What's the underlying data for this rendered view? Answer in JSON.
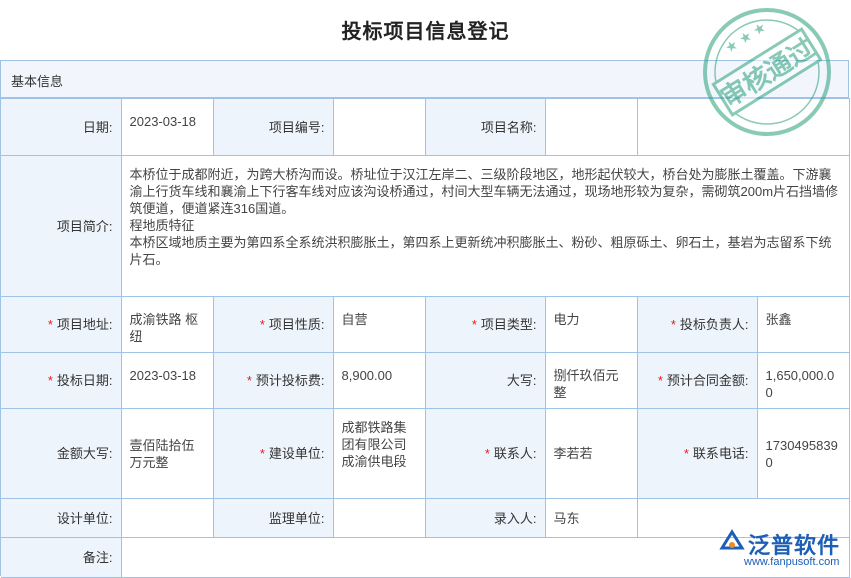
{
  "page_title": "投标项目信息登记",
  "section": "基本信息",
  "stamp_text": "审核通过",
  "fields": {
    "date_label": "日期:",
    "date_value": "2023-03-18",
    "project_no_label": "项目编号:",
    "project_no_value": "",
    "project_name_label": "项目名称:",
    "project_name_value": "",
    "summary_label": "项目简介:",
    "summary_lines": [
      "本桥位于成都附近，为跨大桥沟而设。桥址位于汉江左岸二、三级阶段地区，地形起伏较大，桥台处为膨胀土覆盖。下游襄渝上行货车线和襄渝上下行客车线对应该沟设桥通过，村间大型车辆无法通过，现场地形较为复杂，需砌筑200m片石挡墙修筑便道，便道紧连316国道。",
      "程地质特征",
      "本桥区域地质主要为第四系全系统洪积膨胀土，第四系上更新统冲积膨胀土、粉砂、粗原砾土、卵石土，基岩为志留系下统片石。"
    ],
    "address_label": "项目地址:",
    "address_value": "成渝铁路 枢纽",
    "nature_label": "项目性质:",
    "nature_value": "自营",
    "type_label": "项目类型:",
    "type_value": "电力",
    "owner_label": "投标负责人:",
    "owner_value": "张鑫",
    "bid_date_label": "投标日期:",
    "bid_date_value": "2023-03-18",
    "bid_fee_label": "预计投标费:",
    "bid_fee_value": "8,900.00",
    "upper_label": "大写:",
    "upper_value": "捌仟玖佰元整",
    "contract_amount_label": "预计合同金额:",
    "contract_amount_value": "1,650,000.00",
    "amount_upper_label": "金额大写:",
    "amount_upper_value": "壹佰陆拾伍万元整",
    "builder_label": "建设单位:",
    "builder_value": "成都铁路集团有限公司成渝供电段",
    "contact_label": "联系人:",
    "contact_value": "李若若",
    "phone_label": "联系电话:",
    "phone_value": "17304958390",
    "design_label": "设计单位:",
    "design_value": "",
    "supervise_label": "监理单位:",
    "supervise_value": "",
    "entry_label": "录入人:",
    "entry_value": "马东",
    "remark_label": "备注:",
    "remark_value": ""
  },
  "logo": {
    "brand": "泛普软件",
    "url": "www.fanpusoft.com"
  },
  "colors": {
    "border": "#9fc3e6",
    "label_bg": "#eef4fb",
    "required": "#e02020",
    "brand": "#1d5fb5",
    "stamp": "#2aa07a"
  }
}
